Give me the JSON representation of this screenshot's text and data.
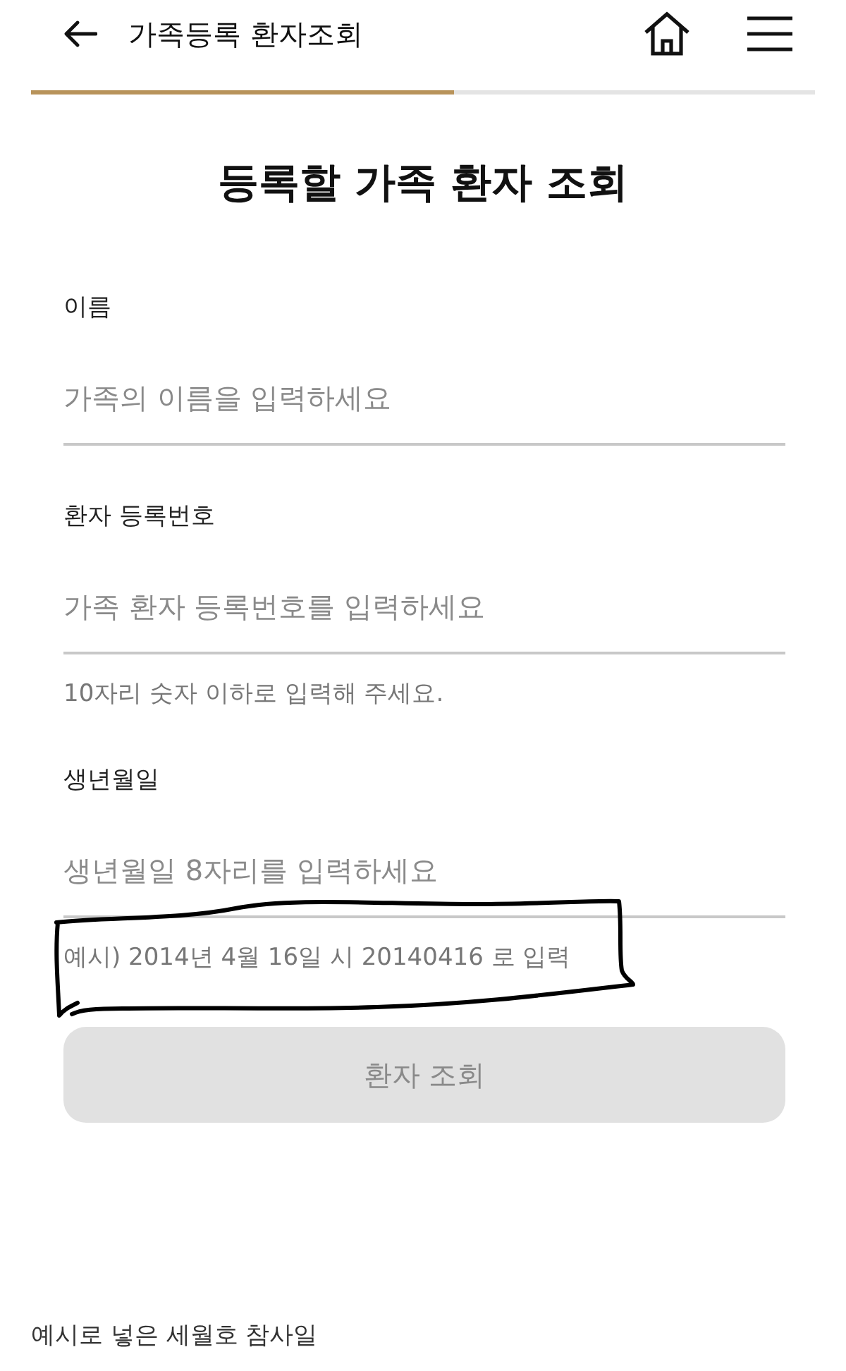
{
  "header": {
    "title": "가족등록 환자조회"
  },
  "progress": {
    "level": 0.54
  },
  "heading": "등록할 가족 환자 조회",
  "fields": [
    {
      "label": "이름",
      "placeholder": "가족의 이름을 입력하세요"
    },
    {
      "label": "환자 등록번호",
      "placeholder": "가족 환자 등록번호를 입력하세요",
      "help": "10자리 숫자 이하로 입력해 주세요."
    },
    {
      "label": "생년월일",
      "placeholder": "생년월일 8자리를 입력하세요",
      "help": "예시) 2014년 4월 16일 시 20140416 로 입력",
      "circled": true
    }
  ],
  "submit": {
    "label": "환자 조회",
    "disabled": true
  },
  "caption": "예시로 넣은 세월호 참사일"
}
